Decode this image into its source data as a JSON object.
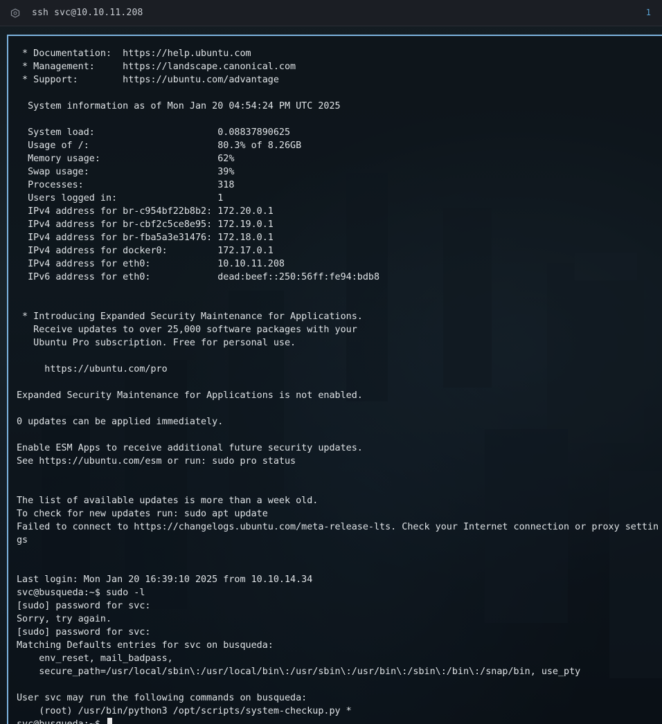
{
  "window": {
    "title": "ssh svc@10.10.11.208",
    "tab_count": "1"
  },
  "terminal": {
    "lines": [
      " * Documentation:  https://help.ubuntu.com",
      " * Management:     https://landscape.canonical.com",
      " * Support:        https://ubuntu.com/advantage",
      "",
      "  System information as of Mon Jan 20 04:54:24 PM UTC 2025",
      "",
      "  System load:                      0.08837890625",
      "  Usage of /:                       80.3% of 8.26GB",
      "  Memory usage:                     62%",
      "  Swap usage:                       39%",
      "  Processes:                        318",
      "  Users logged in:                  1",
      "  IPv4 address for br-c954bf22b8b2: 172.20.0.1",
      "  IPv4 address for br-cbf2c5ce8e95: 172.19.0.1",
      "  IPv4 address for br-fba5a3e31476: 172.18.0.1",
      "  IPv4 address for docker0:         172.17.0.1",
      "  IPv4 address for eth0:            10.10.11.208",
      "  IPv6 address for eth0:            dead:beef::250:56ff:fe94:bdb8",
      "",
      "",
      " * Introducing Expanded Security Maintenance for Applications.",
      "   Receive updates to over 25,000 software packages with your",
      "   Ubuntu Pro subscription. Free for personal use.",
      "",
      "     https://ubuntu.com/pro",
      "",
      "Expanded Security Maintenance for Applications is not enabled.",
      "",
      "0 updates can be applied immediately.",
      "",
      "Enable ESM Apps to receive additional future security updates.",
      "See https://ubuntu.com/esm or run: sudo pro status",
      "",
      "",
      "The list of available updates is more than a week old.",
      "To check for new updates run: sudo apt update",
      "Failed to connect to https://changelogs.ubuntu.com/meta-release-lts. Check your Internet connection or proxy settin",
      "gs",
      "",
      "",
      "Last login: Mon Jan 20 16:39:10 2025 from 10.10.14.34",
      "svc@busqueda:~$ sudo -l",
      "[sudo] password for svc:",
      "Sorry, try again.",
      "[sudo] password for svc:",
      "Matching Defaults entries for svc on busqueda:",
      "    env_reset, mail_badpass,",
      "    secure_path=/usr/local/sbin\\:/usr/local/bin\\:/usr/sbin\\:/usr/bin\\:/sbin\\:/bin\\:/snap/bin, use_pty",
      "",
      "User svc may run the following commands on busqueda:",
      "    (root) /usr/bin/python3 /opt/scripts/system-checkup.py *"
    ],
    "prompt": "svc@busqueda:~$ "
  },
  "colors": {
    "accent": "#7db4e0",
    "text": "#dfe3e6",
    "titlebar": "#1b1e24"
  }
}
